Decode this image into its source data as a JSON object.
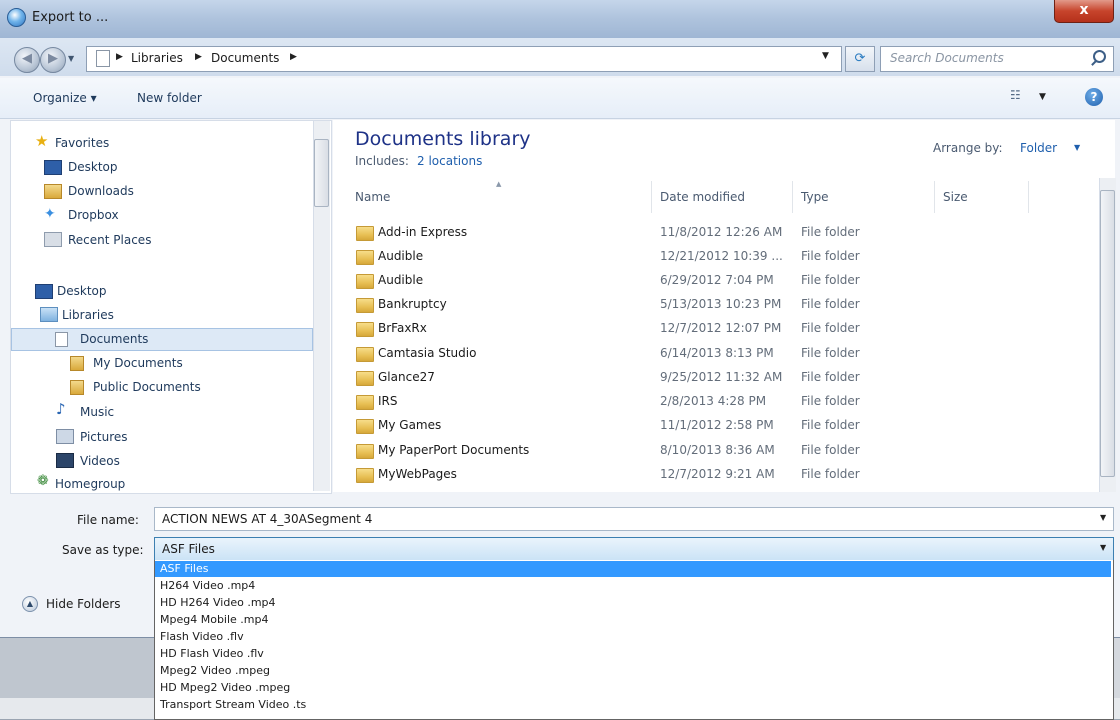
{
  "window": {
    "title": "Export to ...",
    "close_label": "x"
  },
  "nav": {
    "back_glyph": "◀",
    "forward_glyph": "▶",
    "breadcrumb": [
      "Libraries",
      "Documents"
    ],
    "search_placeholder": "Search Documents"
  },
  "toolbar": {
    "organize": "Organize ▾",
    "new_folder": "New folder",
    "help": "?"
  },
  "sidebar": {
    "favorites": {
      "label": "Favorites",
      "items": [
        "Desktop",
        "Downloads",
        "Dropbox",
        "Recent Places"
      ]
    },
    "tree": [
      "Desktop",
      "Libraries",
      "Documents",
      "My Documents",
      "Public Documents",
      "Music",
      "Pictures",
      "Videos",
      "Homegroup"
    ]
  },
  "library": {
    "title": "Documents library",
    "includes_label": "Includes:",
    "locations": "2 locations",
    "arrange_label": "Arrange by:",
    "arrange_value": "Folder"
  },
  "columns": [
    "Name",
    "Date modified",
    "Type",
    "Size"
  ],
  "files": [
    {
      "name": "Add-in Express",
      "date": "11/8/2012 12:26 AM",
      "type": "File folder"
    },
    {
      "name": "Audible",
      "date": "12/21/2012 10:39 ...",
      "type": "File folder"
    },
    {
      "name": "Audible",
      "date": "6/29/2012 7:04 PM",
      "type": "File folder"
    },
    {
      "name": "Bankruptcy",
      "date": "5/13/2013 10:23 PM",
      "type": "File folder"
    },
    {
      "name": "BrFaxRx",
      "date": "12/7/2012 12:07 PM",
      "type": "File folder"
    },
    {
      "name": "Camtasia Studio",
      "date": "6/14/2013 8:13 PM",
      "type": "File folder"
    },
    {
      "name": "Glance27",
      "date": "9/25/2012 11:32 AM",
      "type": "File folder"
    },
    {
      "name": "IRS",
      "date": "2/8/2013 4:28 PM",
      "type": "File folder"
    },
    {
      "name": "My Games",
      "date": "11/1/2012 2:58 PM",
      "type": "File folder"
    },
    {
      "name": "My PaperPort Documents",
      "date": "8/10/2013 8:36 AM",
      "type": "File folder"
    },
    {
      "name": "MyWebPages",
      "date": "12/7/2012 9:21 AM",
      "type": "File folder"
    }
  ],
  "form": {
    "filename_label": "File name:",
    "filename_value": "ACTION NEWS AT 4_30ASegment 4",
    "savetype_label": "Save as type:",
    "savetype_value": "ASF Files",
    "hide_folders": "Hide Folders"
  },
  "savetype_options": [
    "ASF Files",
    "H264 Video .mp4",
    "HD H264 Video .mp4",
    "Mpeg4 Mobile .mp4",
    "Flash Video .flv",
    "HD Flash Video .flv",
    "Mpeg2 Video .mpeg",
    "HD Mpeg2 Video .mpeg",
    "Transport Stream Video .ts"
  ],
  "colors": {
    "accent": "#3399ff",
    "title_blue": "#1e3287",
    "link": "#1f5fad"
  }
}
